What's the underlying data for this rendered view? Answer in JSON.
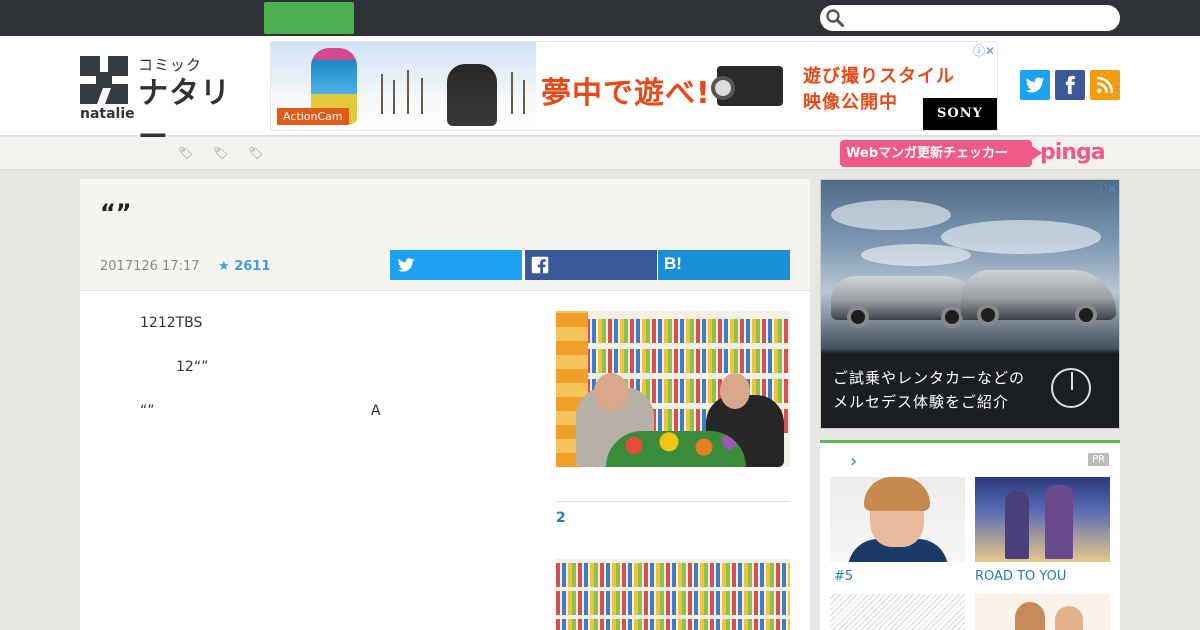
{
  "header": {
    "logo_small": "コミック",
    "logo_big": "ナタリー",
    "logo_en": "natalie"
  },
  "ad_banner": {
    "tag": "ActionCam",
    "headline": "夢中で遊べ!",
    "sub_line1": "遊び撮りスタイル",
    "sub_line2": "映像公開中",
    "brand": "SONY",
    "choice": "ⓘ✕"
  },
  "tagbar": {
    "pinga_label": "Webマンガ更新チェッカー",
    "pinga_logo": "pinga"
  },
  "article": {
    "title": "“”",
    "date": "2017126 17:17",
    "favorites": "2611",
    "share_hatena": "B!",
    "paragraphs": [
      "1212TBS",
      "12“”",
      "“”",
      "A"
    ],
    "figure_caption": "2"
  },
  "sidebar": {
    "ad_text_line1": "ご試乗やレンタカーなどの",
    "ad_text_line2": "メルセデス体験をご紹介",
    "ad_choice": "ⓘ✕",
    "chevron": "›",
    "pr_badge": "PR",
    "thumbs": [
      {
        "label": "#5"
      },
      {
        "label": "ROAD TO YOU"
      }
    ]
  },
  "colors": {
    "topbar": "#2f3237",
    "green": "#4caf50",
    "twitter": "#1da1f2",
    "facebook": "#3b5998",
    "hatena": "#1a8ed7",
    "rss": "#f39c12",
    "pinga": "#f05a87",
    "link": "#2a7ab8"
  },
  "icons": [
    "search-icon",
    "twitter-icon",
    "facebook-icon",
    "rss-icon",
    "tag-icon",
    "star-icon",
    "hatena-icon",
    "chevron-right-icon"
  ]
}
